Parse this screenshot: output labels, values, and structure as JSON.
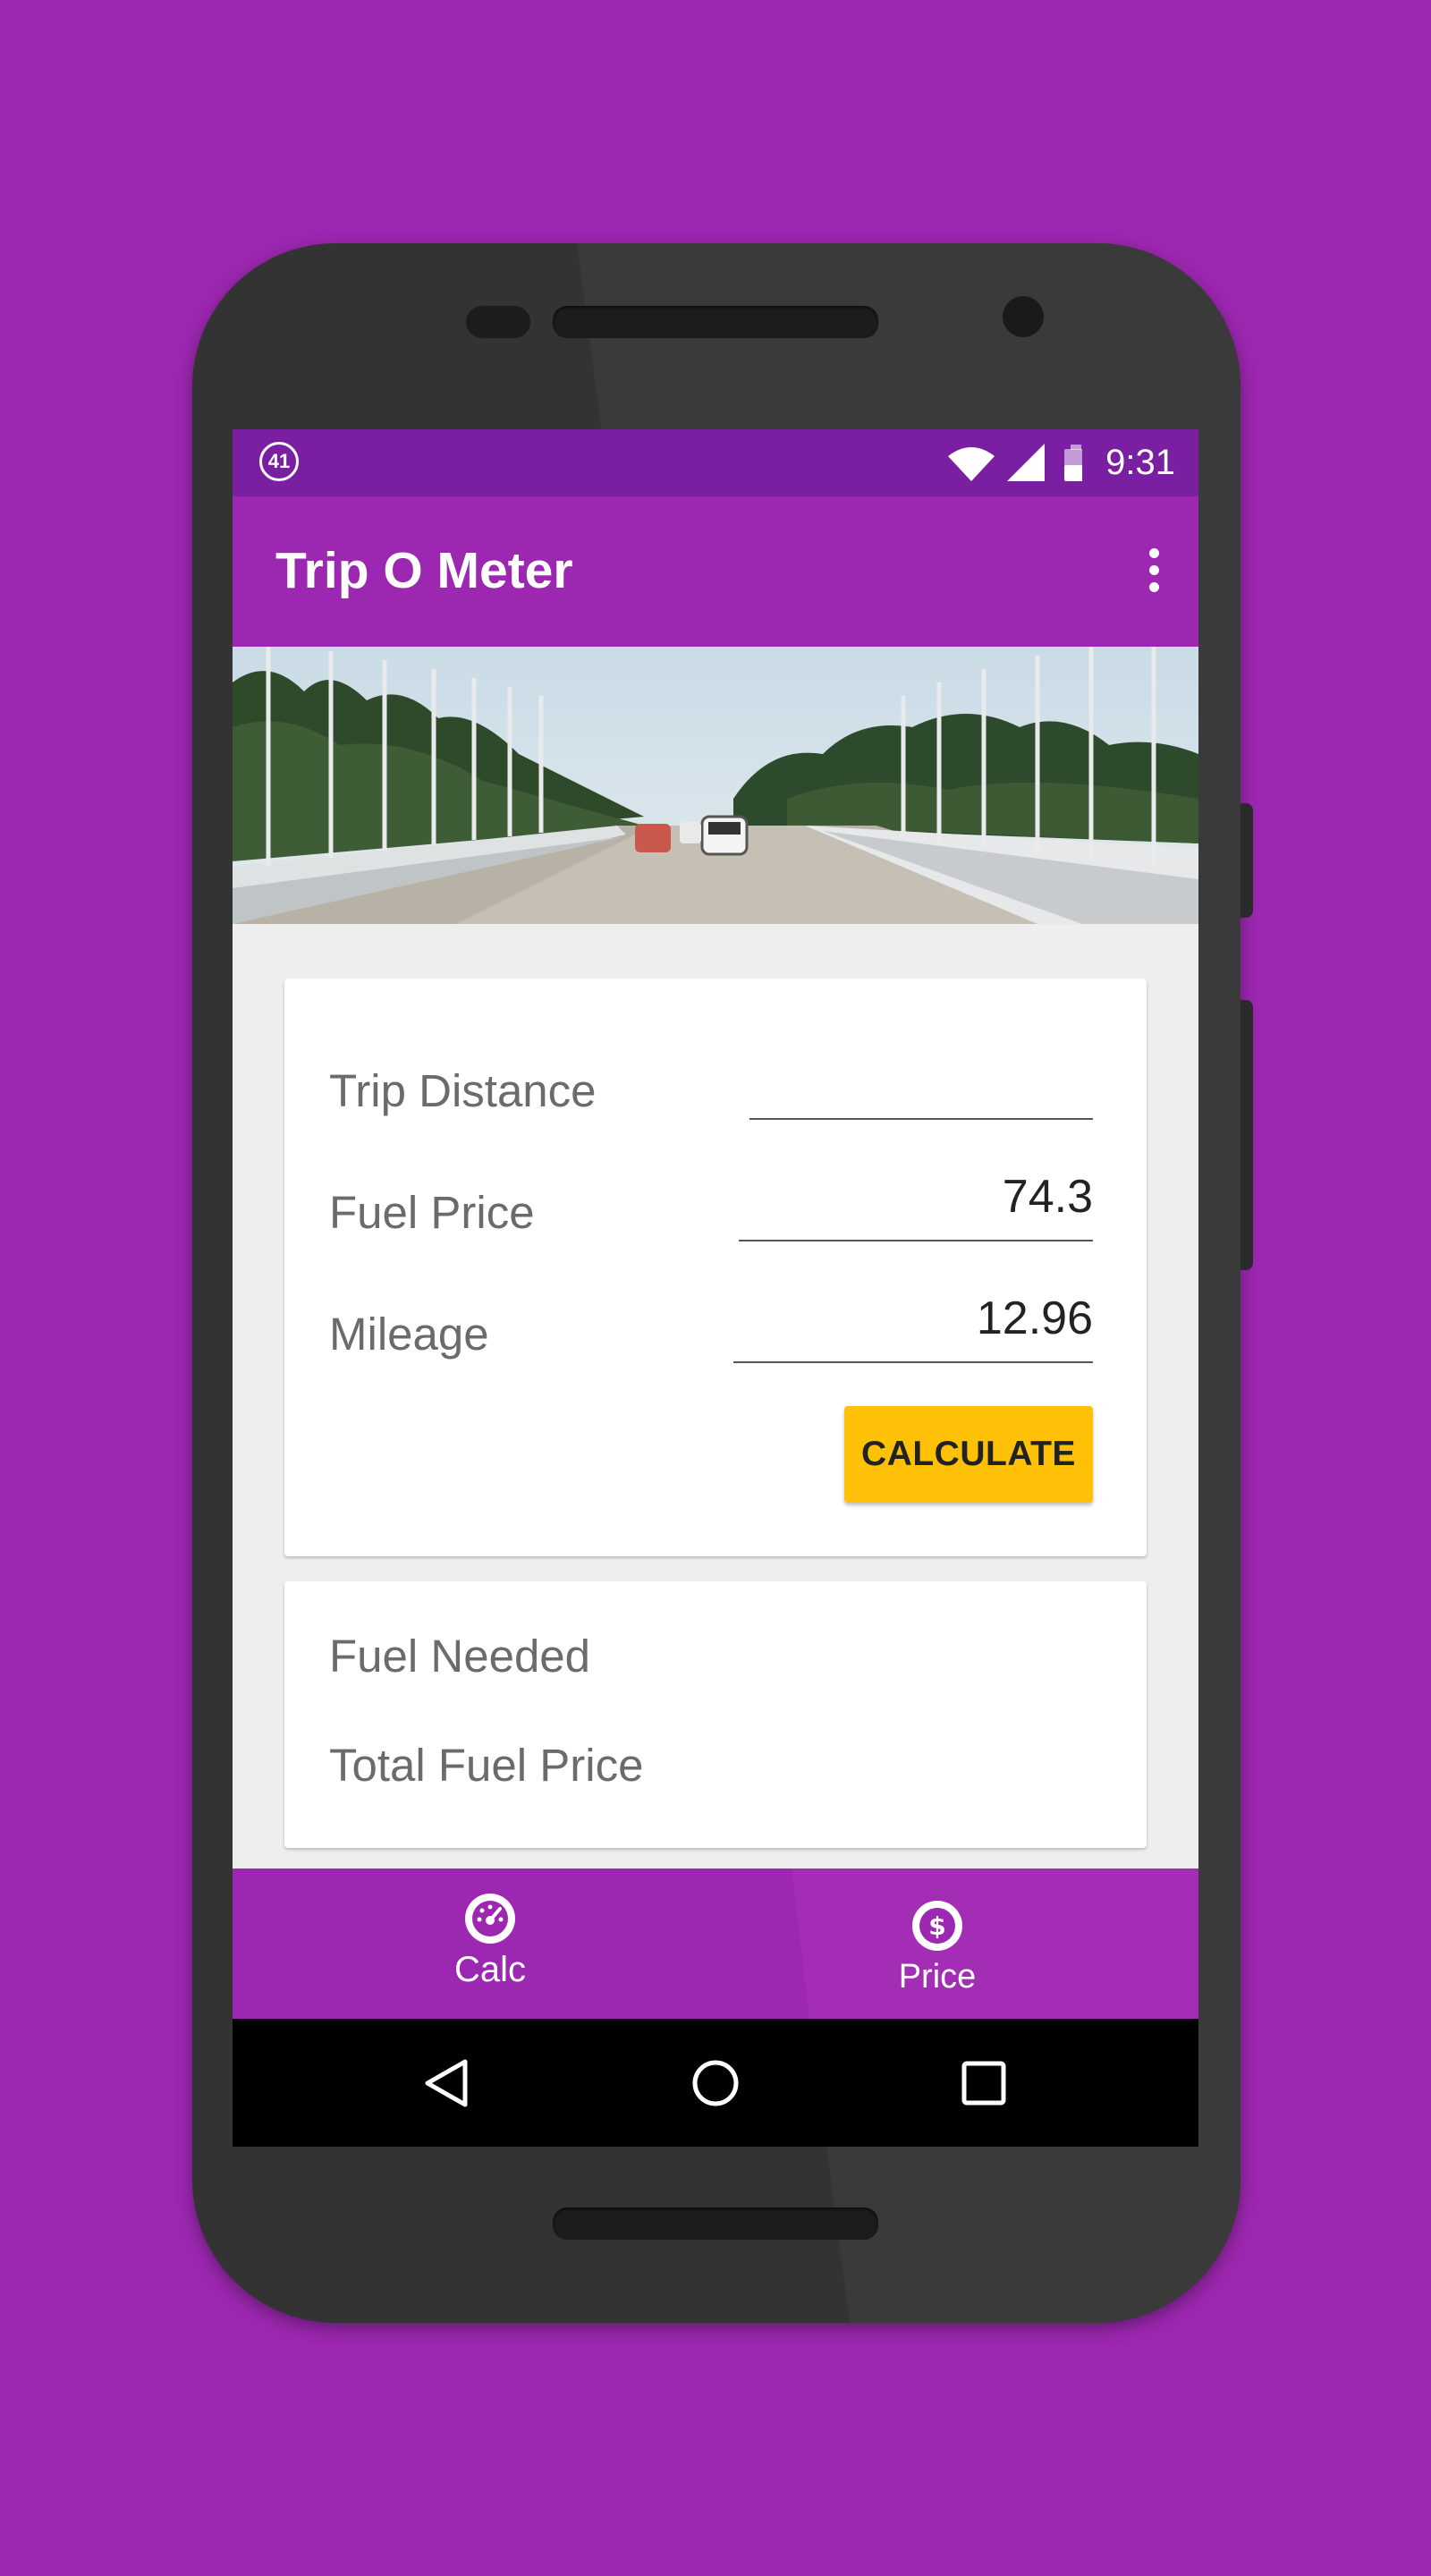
{
  "status_bar": {
    "notification_badge": "41",
    "time": "9:31",
    "icons": [
      "wifi-icon",
      "signal-icon",
      "battery-icon"
    ]
  },
  "app_bar": {
    "title": "Trip O Meter",
    "menu_icon": "overflow-menu-icon"
  },
  "hero": {
    "description_icon": "road-photo"
  },
  "trip_form": {
    "trip_distance": {
      "label": "Trip Distance",
      "value": ""
    },
    "fuel_price": {
      "label": "Fuel Price",
      "value": "74.3"
    },
    "mileage": {
      "label": "Mileage",
      "value": "12.96"
    },
    "calculate_label": "CALCULATE"
  },
  "results": {
    "fuel_needed_label": "Fuel Needed",
    "total_fuel_price_label": "Total Fuel Price"
  },
  "bottom_nav": {
    "items": [
      {
        "label": "Calc",
        "icon": "speedometer-icon"
      },
      {
        "label": "Price",
        "icon": "dollar-icon"
      }
    ]
  },
  "system_nav": {
    "icons": [
      "back-icon",
      "home-icon",
      "recents-icon"
    ]
  },
  "colors": {
    "primary": "#9C27B0",
    "primary_dark": "#7B1FA2",
    "accent": "#FFC107",
    "background": "#EEEEEE"
  }
}
